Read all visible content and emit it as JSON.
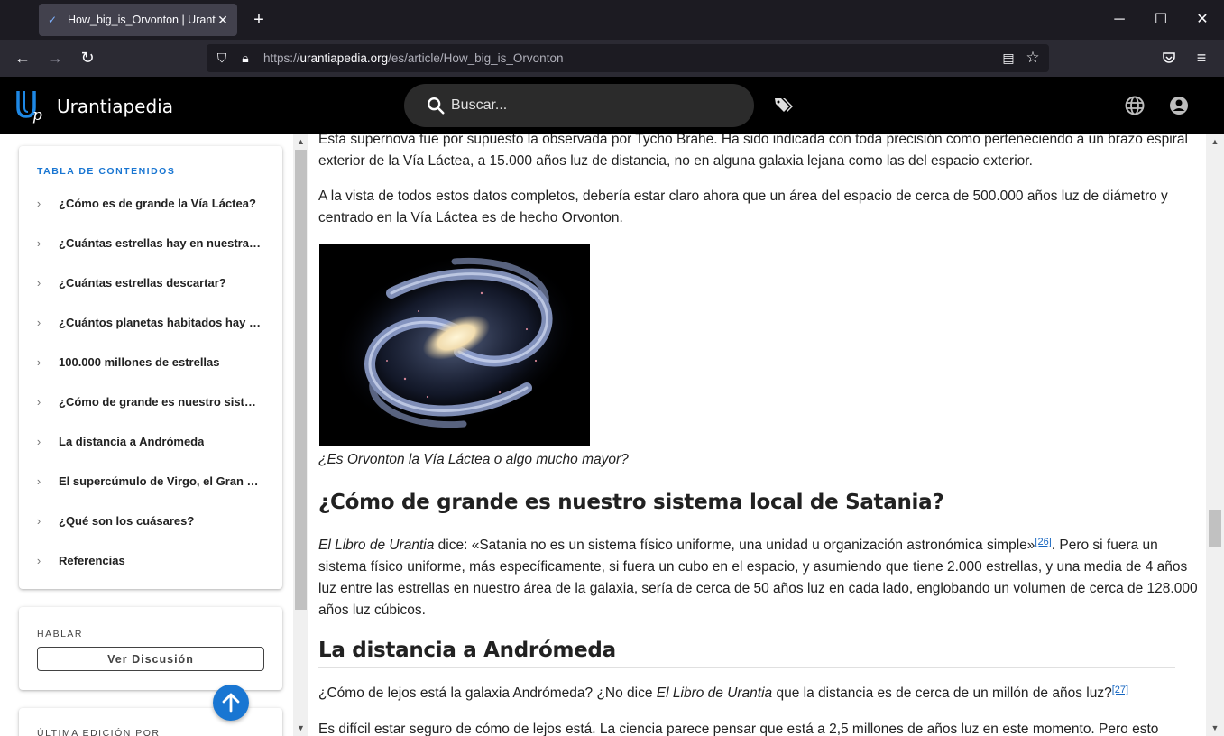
{
  "browser": {
    "tab_title": "How_big_is_Orvonton | Urantiapedia",
    "url_prefix": "https://",
    "url_host": "urantiapedia.org",
    "url_path": "/es/article/How_big_is_Orvonton",
    "icons": {
      "new_tab": "plus-icon",
      "minimize": "minimize-icon",
      "maximize": "maximize-icon",
      "close": "close-icon",
      "back": "arrow-left-icon",
      "forward": "arrow-right-icon",
      "reload": "reload-icon",
      "shield": "shield-icon",
      "lock": "lock-icon",
      "reader": "reader-view-icon",
      "bookmark": "star-icon",
      "pocket": "pocket-icon",
      "menu": "hamburger-menu-icon"
    }
  },
  "site": {
    "name": "Urantiapedia",
    "search_placeholder": "Buscar...",
    "icons": [
      "tag-icon",
      "globe-icon",
      "account-icon"
    ]
  },
  "sidebar": {
    "toc_title": "TABLA DE CONTENIDOS",
    "toc_items": [
      "¿Cómo es de grande la Vía Láctea?",
      "¿Cuántas estrellas hay en nuestra galaxia?",
      "¿Cuántas estrellas descartar?",
      "¿Cuántos planetas habitados hay en nuestra galaxia?",
      "100.000 millones de estrellas",
      "¿Cómo de grande es nuestro sistema local de Satania?",
      "La distancia a Andrómeda",
      "El supercúmulo de Virgo, el Gran Muro",
      "¿Qué son los cuásares?",
      "Referencias"
    ],
    "talk_title": "HABLAR",
    "talk_button": "Ver Discusión",
    "last_edit_title": "ÚLTIMA EDICIÓN POR"
  },
  "content": {
    "p1": "Esta supernova fue por supuesto la observada por Tycho Brahe. Ha sido indicada con toda precisión como perteneciendo a un brazo espiral exterior de la Vía Láctea, a 15.000 años luz de distancia, no en alguna galaxia lejana como las del espacio exterior.",
    "p2": "A la vista de todos estos datos completos, debería estar claro ahora que un área del espacio de cerca de 500.000 años luz de diámetro y centrado en la Vía Láctea es de hecho Orvonton.",
    "image_caption": "¿Es Orvonton la Vía Láctea o algo mucho mayor?",
    "h_satania": "¿Cómo de grande es nuestro sistema local de Satania?",
    "p3_book": "El Libro de Urantia",
    "p3_a": " dice: «Satania no es un sistema físico uniforme, una unidad u organización astronómica simple»",
    "p3_ref": "[26]",
    "p3_b": ". Pero si fuera un sistema físico uniforme, más específicamente, si fuera un cubo en el espacio, y asumiendo que tiene 2.000 estrellas, y una media de 4 años luz entre las estrellas en nuestro área de la galaxia, sería de cerca de 50 años luz en cada lado, englobando un volumen de cerca de 128.000 años luz cúbicos.",
    "h_andromeda": "La distancia a Andrómeda",
    "p4_a": "¿Cómo de lejos está la galaxia Andrómeda? ¿No dice ",
    "p4_book": "El Libro de Urantia",
    "p4_b": " que la distancia es de cerca de un millón de años luz?",
    "p4_ref": "[27]",
    "p5": "Es difícil estar seguro de cómo de lejos está. La ciencia parece pensar que está a 2,5 millones de años luz en este momento. Pero esto"
  },
  "colors": {
    "accent": "#1976d2",
    "header_bg": "#000000",
    "browser_bg": "#1c1b22",
    "toolbar_bg": "#2b2a33"
  }
}
